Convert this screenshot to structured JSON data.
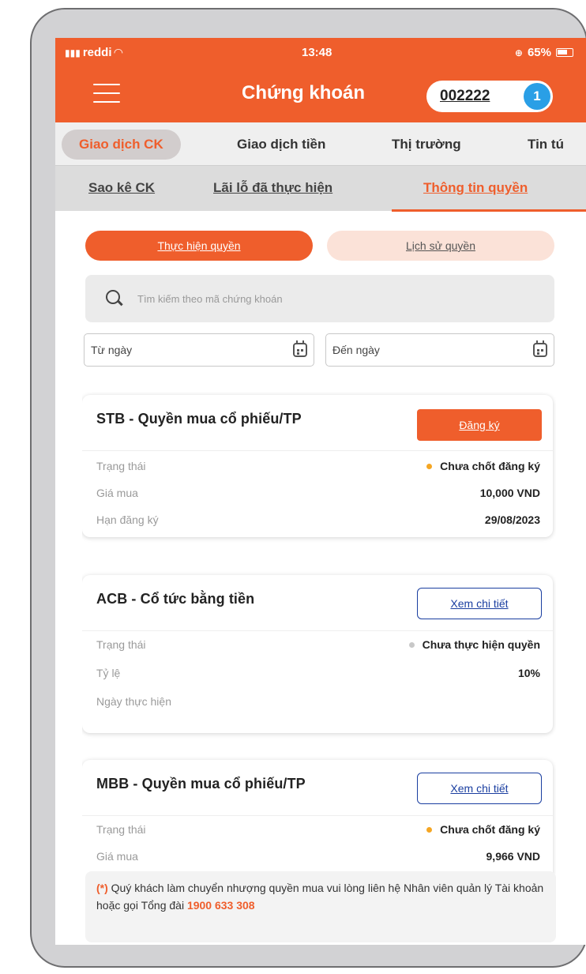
{
  "statusbar": {
    "carrier": "reddi",
    "time": "13:48",
    "battery": "65%"
  },
  "header": {
    "title": "Chứng khoán",
    "account_number": "002222",
    "account_badge": "1"
  },
  "primary_tabs": [
    {
      "label": "Giao dịch CK"
    },
    {
      "label": "Giao dịch tiền"
    },
    {
      "label": "Thị trường"
    },
    {
      "label": "Tin tú"
    }
  ],
  "secondary_tabs": [
    {
      "label": "Sao kê CK"
    },
    {
      "label": "Lãi lỗ đã thực hiện"
    },
    {
      "label": "Thông tin quyền"
    }
  ],
  "toggle": {
    "primary": "Thực hiện quyền",
    "secondary": "Lịch sử quyền"
  },
  "search": {
    "placeholder": "Tìm kiếm theo mã chứng khoán"
  },
  "date_filters": {
    "from_placeholder": "Từ ngày",
    "to_placeholder": "Đến ngày"
  },
  "cards": [
    {
      "title": "STB - Quyền mua cổ phiếu/TP",
      "action_label": "Đăng ký",
      "rows": [
        {
          "label": "Trạng thái",
          "value": "Chưa chốt đăng ký"
        },
        {
          "label": "Giá mua",
          "value": "10,000 VND"
        },
        {
          "label": "Hạn đăng ký",
          "value": "29/08/2023"
        }
      ]
    },
    {
      "title": "ACB - Cổ tức bằng tiền",
      "action_label": "Xem chi tiết",
      "rows": [
        {
          "label": "Trạng thái",
          "value": "Chưa thực hiện quyền"
        },
        {
          "label": "Tỷ lệ",
          "value": "10%"
        },
        {
          "label": "Ngày thực hiện",
          "value": ""
        }
      ]
    },
    {
      "title": "MBB - Quyền mua cổ phiếu/TP",
      "action_label": "Xem chi tiết",
      "rows": [
        {
          "label": "Trạng thái",
          "value": "Chưa chốt đăng ký"
        },
        {
          "label": "Giá mua",
          "value": "9,966 VND"
        }
      ]
    }
  ],
  "note": {
    "prefix": "(*)",
    "text": "Quý khách làm chuyển nhượng quyền mua vui lòng liên hệ Nhân viên quản lý Tài khoản hoặc gọi Tổng đài",
    "hotline": "1900 633 308"
  },
  "colors": {
    "brand": "#ef5e2c",
    "badge": "#2a9fe6",
    "link_blue": "#1a3ea0",
    "status_pending": "#f5a623",
    "status_idle": "#c8c8c8"
  }
}
